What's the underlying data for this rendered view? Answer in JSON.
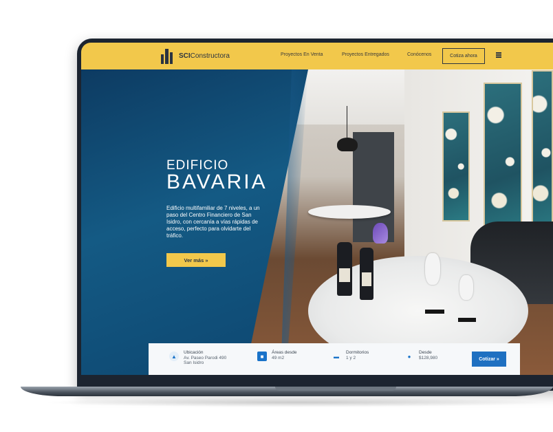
{
  "brand": {
    "name_bold": "SCI",
    "name_rest": "Constructora"
  },
  "nav": {
    "items": [
      "Proyectos En Venta",
      "Proyectos Entregados",
      "Conócenos"
    ],
    "cta": "Cotiza ahora",
    "menu_icon": "hamburger-icon"
  },
  "hero": {
    "title_line1": "EDIFICIO",
    "title_line2": "BAVARIA",
    "description": "Edificio multifamiliar de 7 niveles, a un paso del Centro Financiero de San Isidro, con cercanía a vías rápidas de acceso, perfecto para olvidarte del tráfico.",
    "button": "Ver más »"
  },
  "info_bar": {
    "location": {
      "label": "Ubicación",
      "line1": "Av. Paseo Parodi 490",
      "line2": "San Isidro",
      "icon": "building-icon"
    },
    "area": {
      "label": "Áreas desde",
      "value": "49 m2",
      "icon": "area-icon"
    },
    "rooms": {
      "label": "Dormitorios",
      "value": "1 y 2",
      "icon": "bed-icon"
    },
    "price": {
      "label": "Desde",
      "value": "$128,980",
      "icon": "price-tag-icon"
    },
    "cta": "Cotizar »"
  },
  "colors": {
    "accent": "#f2c84b",
    "primary": "#0d3b62",
    "button_blue": "#1f70c1"
  }
}
